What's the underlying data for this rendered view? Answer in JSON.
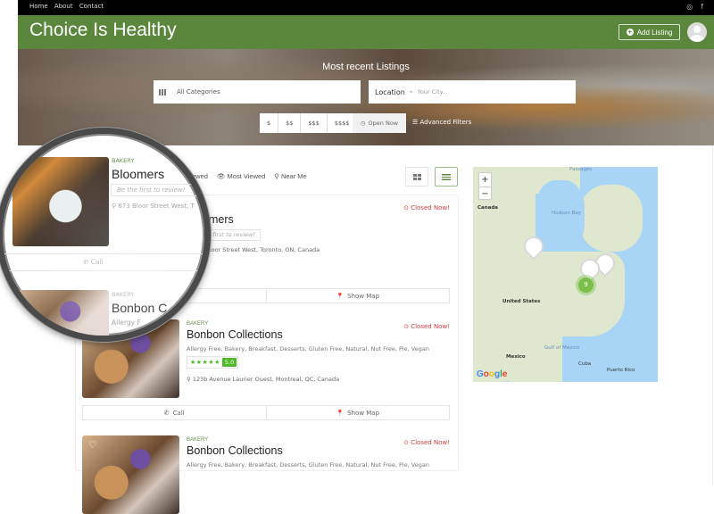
{
  "topbar": {
    "links": [
      "Home",
      "About",
      "Contact"
    ],
    "social": [
      {
        "icon": "instagram-icon",
        "glyph": "◎"
      },
      {
        "icon": "facebook-icon",
        "glyph": "f"
      }
    ]
  },
  "header": {
    "brand": "Choice Is Healthy",
    "add_listing_label": "Add Listing",
    "brand_color": "#5a873b"
  },
  "hero": {
    "title": "Most recent Listings",
    "category_value": "All Categories",
    "location_label": "Location",
    "location_placeholder": "Your City...",
    "price_options": [
      "$",
      "$$",
      "$$$",
      "$$$$"
    ],
    "open_now_label": "Open Now",
    "advanced_filters_label": "Advanced Filters"
  },
  "sort_bar": {
    "options": [
      {
        "icon": "star-icon",
        "label": "Reviewed"
      },
      {
        "icon": "eye-icon",
        "label": "Most Viewed"
      },
      {
        "icon": "map-marker-icon",
        "label": "Near Me"
      }
    ]
  },
  "listings": [
    {
      "category": "BAKERY",
      "name": "Bloomers",
      "review_prompt": "Be the first to review!",
      "address": "873 Bloor Street West, Toronto, ON, Canada",
      "status": "Closed Now!",
      "actions": [
        "Call",
        "Show Map"
      ]
    },
    {
      "category": "BAKERY",
      "name": "Bonbon Collections",
      "tags": "Allergy Free, Bakery, Breakfast, Desserts, Gluten Free, Natural, Nut Free, Pie, Vegan",
      "rating_stars": 5,
      "rating_score": "5.0",
      "address": "123b Avenue Laurier Ouest, Montreal, QC, Canada",
      "status": "Closed Now!",
      "actions": [
        "Call",
        "Show Map"
      ]
    },
    {
      "category": "BAKERY",
      "name": "Bonbon Collections",
      "tags": "Allergy Free, Bakery, Breakfast, Desserts, Gluten Free, Natural, Nut Free, Pie, Vegan",
      "status": "Closed Now!"
    }
  ],
  "map": {
    "zoom_in": "+",
    "zoom_out": "−",
    "labels": [
      "Canada",
      "Hudson Bay",
      "United States",
      "Mexico",
      "Gulf of Mexico",
      "Cuba",
      "Puerto Rico",
      "Passages"
    ],
    "cluster_count": "9",
    "attribution": "Google"
  },
  "magnifier": {
    "category": "BAKERY",
    "name": "Bloomers",
    "review_prompt": "Be the first to review!",
    "address": "873 Bloor Street West, T",
    "call_label": "Call",
    "category2": "BAKERY",
    "name2": "Bonbon C",
    "tags2": "Allergy F"
  }
}
